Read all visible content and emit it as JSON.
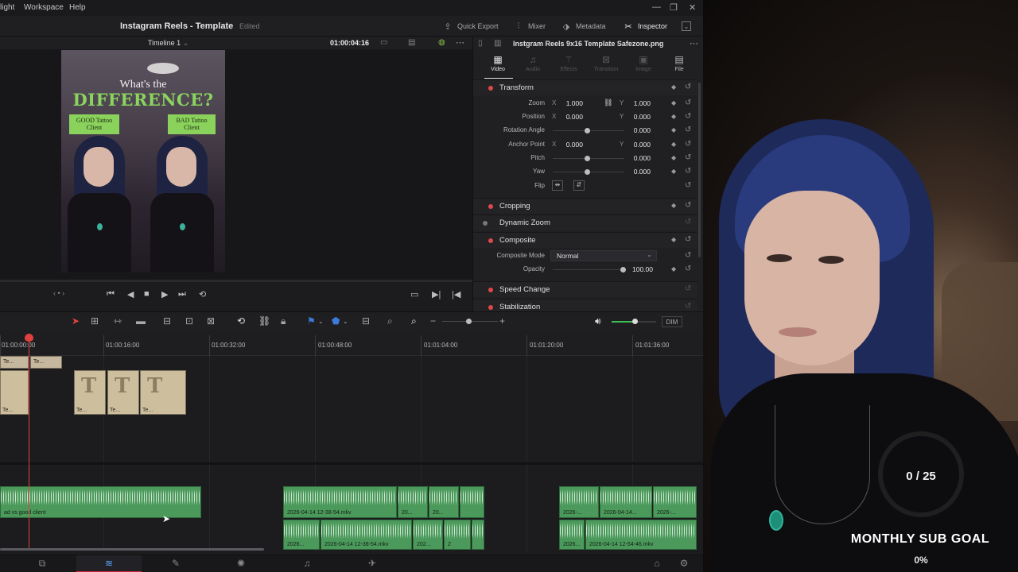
{
  "menubar": {
    "items": [
      "light",
      "Workspace",
      "Help"
    ],
    "win_min": "—",
    "win_max": "❐",
    "win_close": "✕"
  },
  "title": {
    "project": "Instagram Reels - Template",
    "status": "Edited"
  },
  "toolbar": {
    "quick_export": "Quick Export",
    "mixer": "Mixer",
    "metadata": "Metadata",
    "inspector": "Inspector"
  },
  "viewer": {
    "timeline_name": "Timeline 1",
    "timecode": "01:00:04:16",
    "frame_title_1": "What's the",
    "frame_title_2": "DIFFERENCE?",
    "tag_left": "GOOD Tattoo Client",
    "tag_right": "BAD Tattoo Client"
  },
  "inspector": {
    "file": "Instgram Reels 9x16 Template Safezone.png",
    "tabs": [
      {
        "label": "Video",
        "icon": "film-icon",
        "active": true
      },
      {
        "label": "Audio",
        "icon": "music-icon",
        "active": false
      },
      {
        "label": "Effects",
        "icon": "wand-icon",
        "active": false
      },
      {
        "label": "Transition",
        "icon": "transition-icon",
        "active": false
      },
      {
        "label": "Image",
        "icon": "image-icon",
        "active": false
      },
      {
        "label": "File",
        "icon": "file-icon",
        "active": false
      }
    ],
    "transform": {
      "title": "Transform",
      "zoom_label": "Zoom",
      "zoom_x": "1.000",
      "zoom_y": "1.000",
      "position_label": "Position",
      "position_x": "0.000",
      "position_y": "0.000",
      "rotation_label": "Rotation Angle",
      "rotation": "0.000",
      "anchor_label": "Anchor Point",
      "anchor_x": "0.000",
      "anchor_y": "0.000",
      "pitch_label": "Pitch",
      "pitch": "0.000",
      "yaw_label": "Yaw",
      "yaw": "0.000",
      "flip_label": "Flip",
      "axis_x": "X",
      "axis_y": "Y"
    },
    "cropping": "Cropping",
    "dynamic_zoom": "Dynamic Zoom",
    "composite": {
      "title": "Composite",
      "mode_label": "Composite Mode",
      "mode_value": "Normal",
      "opacity_label": "Opacity",
      "opacity": "100.00"
    },
    "speed_change": "Speed Change",
    "stabilization": "Stabilization"
  },
  "timeline": {
    "dim_label": "DIM",
    "timecodes": [
      "01:00:00:00",
      "01:00:16:00",
      "01:00:32:00",
      "01:00:48:00",
      "01:01:04:00",
      "01:01:20:00",
      "01:01:36:00"
    ],
    "text_clip_label": "Te...",
    "title_letter": "T",
    "audio_clips": {
      "a1": "ad vs good client",
      "b1": "2026-04-14 12-38-54.mkv",
      "b2": "20...",
      "b3": "20...",
      "c1": "2026-...",
      "c2": "2026-04-14...",
      "c3": "2026-...",
      "d1": "2026...",
      "d2": "2026-04-14 12-38-54.mkv",
      "d3": "202...",
      "d4": "2",
      "e1": "2026...",
      "e2": "2026-04-14 12-54-46.mkv"
    }
  },
  "overlay": {
    "count": "0 / 25",
    "label": "MONTHLY SUB GOAL",
    "percent": "0%",
    "progress": 0
  },
  "colors": {
    "accent_red": "#e0413f",
    "audio_green": "#4b9a5b",
    "title_green": "#8bd45e",
    "clip_tan": "#c6b89e"
  }
}
